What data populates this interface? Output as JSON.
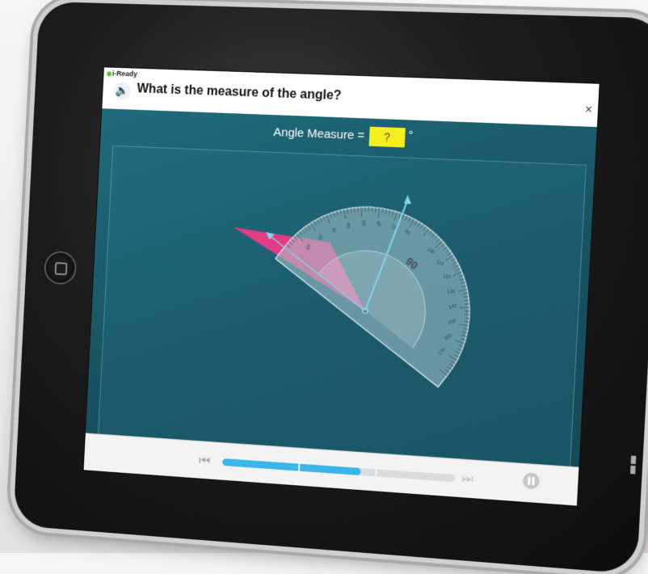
{
  "device": {
    "status_label": "iPad"
  },
  "app": {
    "brand": "i-Ready",
    "question": "What is the measure of the angle?",
    "close_label": "×",
    "speaker_icon": "speaker-icon"
  },
  "prompt": {
    "label": "Angle Measure =",
    "input_value": "?",
    "unit": "°"
  },
  "protractor": {
    "tick_labels": [
      "10",
      "20",
      "30",
      "40",
      "50",
      "60",
      "70",
      "80",
      "90",
      "100",
      "110",
      "120",
      "130",
      "140",
      "150",
      "160",
      "170"
    ],
    "large_label": "90"
  },
  "navigation": {
    "prev_icon": "skip-back-icon",
    "next_icon": "skip-forward-icon",
    "pause_icon": "pause-icon",
    "progress_fraction": 0.6
  },
  "colors": {
    "accent": "#3ab7e8",
    "answer_box": "#f6ee1e",
    "angle_fill": "#e23c86",
    "background": "#1b5768"
  }
}
